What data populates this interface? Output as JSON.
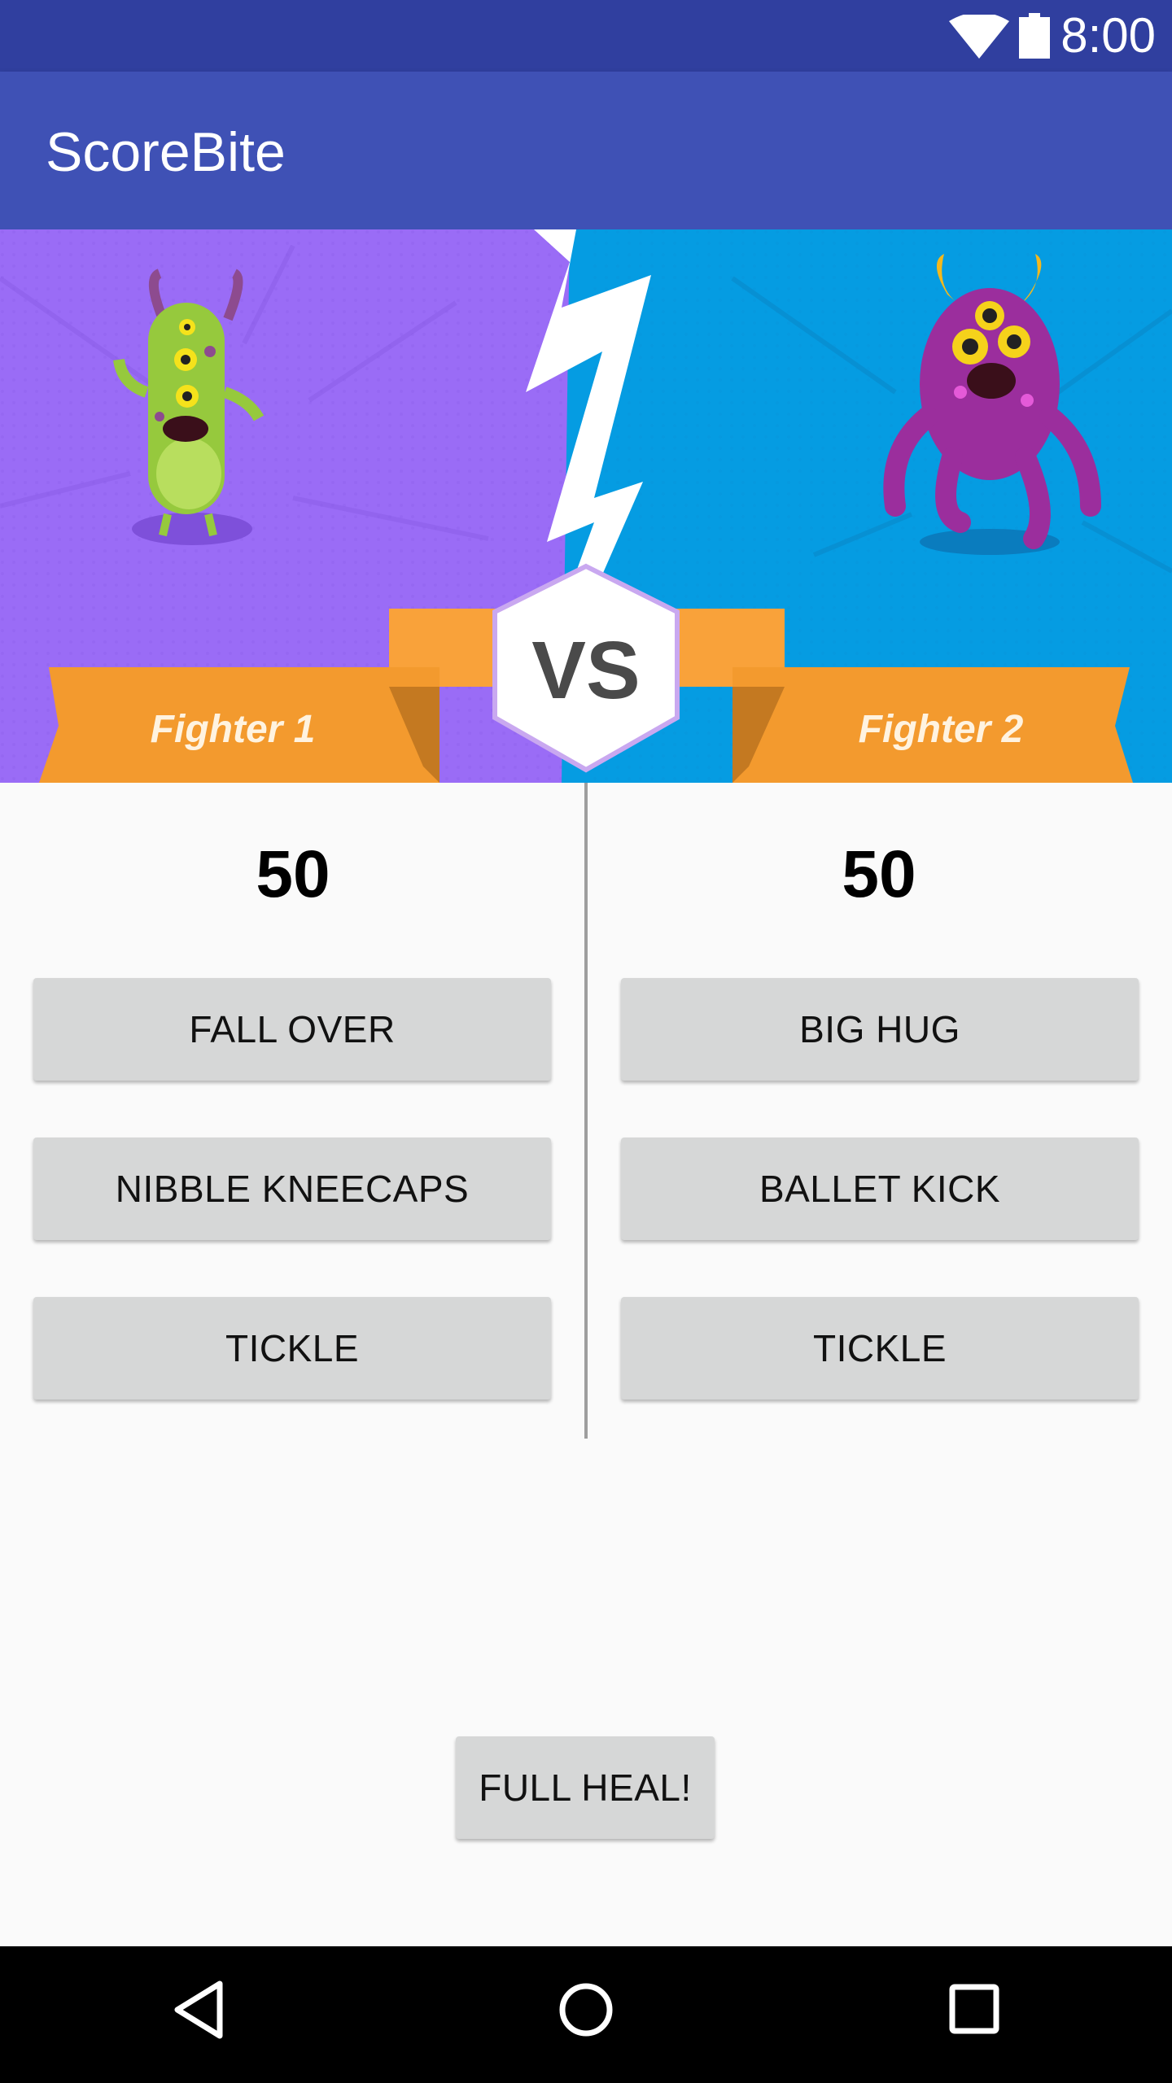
{
  "status": {
    "time": "8:00",
    "icons": [
      "wifi-icon",
      "battery-icon"
    ]
  },
  "app": {
    "title": "ScoreBite"
  },
  "banner": {
    "fighter1_label": "Fighter 1",
    "fighter2_label": "Fighter 2",
    "vs_label": "VS"
  },
  "fighter1": {
    "score": "50",
    "actions": [
      "FALL OVER",
      "NIBBLE KNEECAPS",
      "TICKLE"
    ]
  },
  "fighter2": {
    "score": "50",
    "actions": [
      "BIG HUG",
      "BALLET KICK",
      "TICKLE"
    ]
  },
  "heal_label": "FULL HEAL!",
  "colors": {
    "statusbar": "#303F9F",
    "appbar": "#3F51B5",
    "left_bg": "#9A6CF6",
    "right_bg": "#059CE2",
    "ribbon": "#F39A2E"
  },
  "nav": {
    "icons": [
      "back-icon",
      "home-icon",
      "recents-icon"
    ]
  }
}
